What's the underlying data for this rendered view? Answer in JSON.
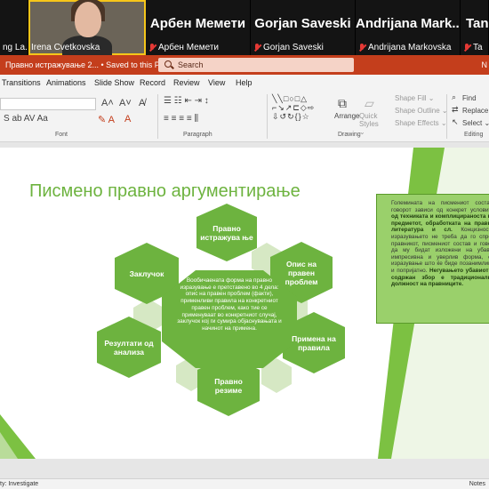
{
  "video": {
    "participants": [
      {
        "name": "ng La...",
        "type": "partial"
      },
      {
        "name": "Irena Cvetkovska",
        "type": "video"
      },
      {
        "name": "Арбен Мемети",
        "type": "name"
      },
      {
        "name": "Gorjan Saveski",
        "type": "name"
      },
      {
        "name": "Andrijana Mark...",
        "label": "Andrijana Markovska",
        "type": "name"
      },
      {
        "name": "Tan",
        "label": "Ta",
        "type": "name"
      }
    ]
  },
  "titlebar": {
    "doc_title": "Правно истражување 2...  •  Saved to this PC ⌄",
    "search_placeholder": "Search",
    "user": "N"
  },
  "tabs": [
    "Transitions",
    "Animations",
    "Slide Show",
    "Record",
    "Review",
    "View",
    "Help"
  ],
  "ribbon": {
    "groups": [
      "Font",
      "Paragraph",
      "Drawing",
      "Editing"
    ],
    "arrange": "Arrange",
    "quick_styles": "Quick Styles ⌄",
    "shape_fill": "Shape Fill ⌄",
    "shape_outline": "Shape Outline ⌄",
    "shape_effects": "Shape Effects ⌄",
    "find": "Find",
    "replace": "Replace ⌄",
    "select": "Select ⌄"
  },
  "slide": {
    "title": "Писмено правно аргументирање",
    "hexagons": {
      "top": "Правно истражува ње",
      "left": "Заклучок",
      "right_top": "Опис на правен проблем",
      "left_bottom": "Резултати од анализа",
      "right_bottom": "Примена на правила",
      "bottom": "Правно резиме"
    },
    "center_text": "Вообичаената форма на правно изразување е претставено во 4 дела: опис на правен проблем (факти), применливи правила на конкретниот правен проблем, како тие се применуваат во конкретниот случај, заклучок кој ги сумира објаснувањата и начинот на примена.",
    "note": {
      "p1": "Големината на писмениот состав, говорот зависи од конкрет условите ",
      "b1": "од техниката и комплицираноста на предметот, обработката на правна литература и сл.",
      "p2": " Концизноста изразувањето не треба да го спреч правникот, писмениот состав и говор да му бидат изложени на убаво, импресивна и уверлив форма, со изразување што ќе биде позанимливо и попријатно. ",
      "b2": "Негувањето убавиот и содржан збор е традиционална должност на правниците."
    }
  },
  "status": {
    "left": "ty: Investigate",
    "right": "Notes"
  },
  "colors": {
    "accent": "#c43e1c",
    "hex_green": "#6db33f",
    "hex_light": "#d6e8c4"
  }
}
